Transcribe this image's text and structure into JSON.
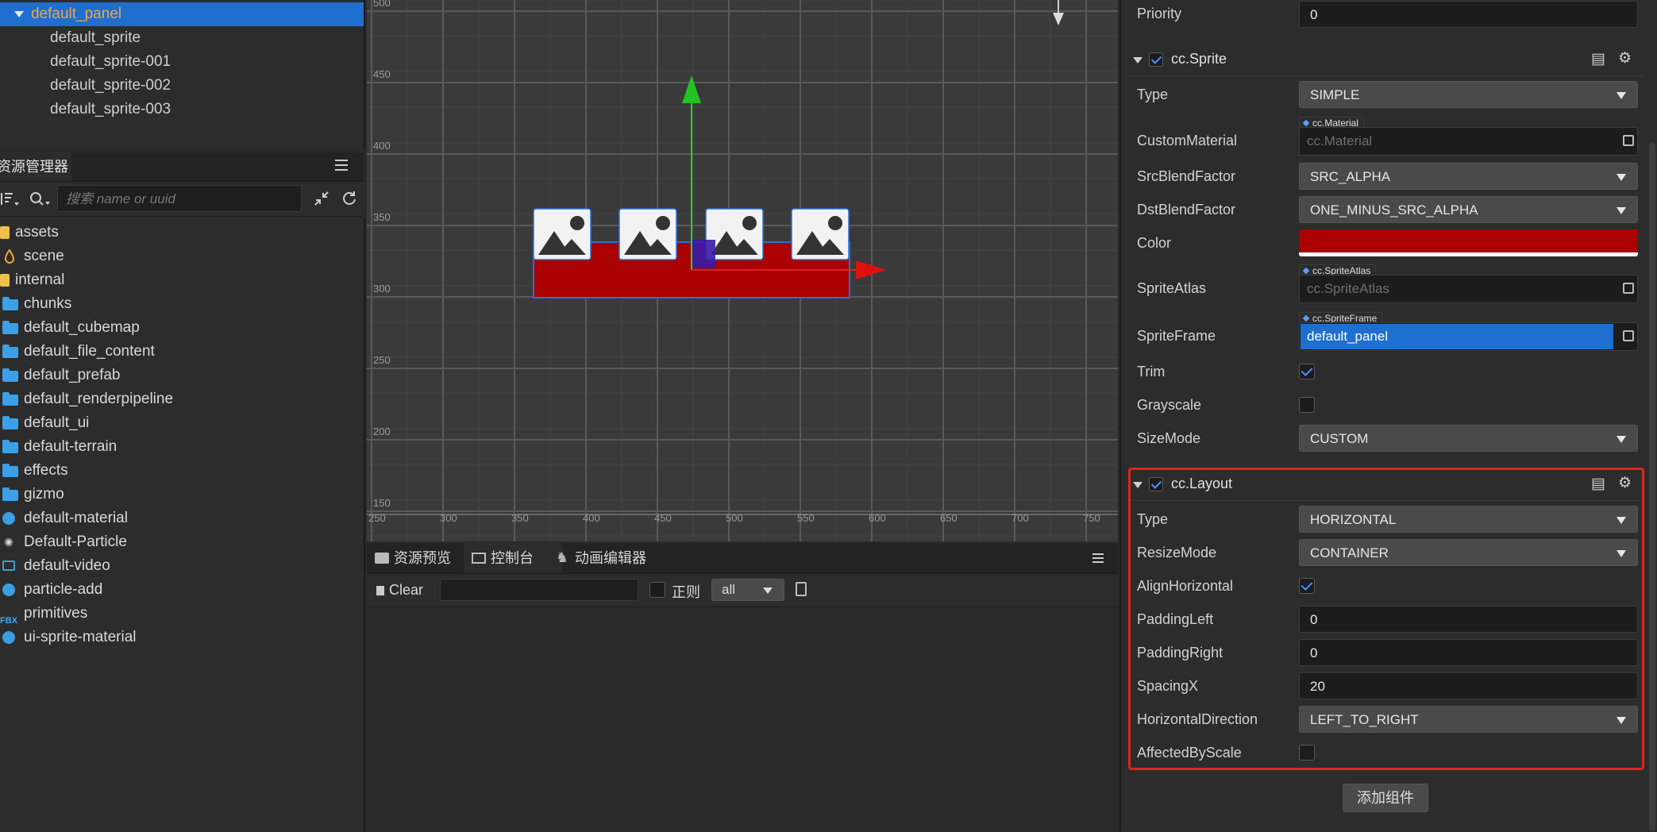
{
  "hierarchy": {
    "items": [
      {
        "label": "default_panel",
        "selected": true
      },
      {
        "label": "default_sprite"
      },
      {
        "label": "default_sprite-001"
      },
      {
        "label": "default_sprite-002"
      },
      {
        "label": "default_sprite-003"
      }
    ]
  },
  "assets": {
    "tab_label": "资源管理器",
    "search_placeholder": "搜索 name or uuid",
    "items": [
      {
        "label": "assets",
        "icon": "database-icon"
      },
      {
        "label": "scene",
        "icon": "scene-icon"
      },
      {
        "label": "internal",
        "icon": "database-icon"
      },
      {
        "label": "chunks",
        "icon": "folder-icon"
      },
      {
        "label": "default_cubemap",
        "icon": "folder-icon"
      },
      {
        "label": "default_file_content",
        "icon": "folder-icon"
      },
      {
        "label": "default_prefab",
        "icon": "folder-icon"
      },
      {
        "label": "default_renderpipeline",
        "icon": "folder-icon"
      },
      {
        "label": "default_ui",
        "icon": "folder-icon"
      },
      {
        "label": "default-terrain",
        "icon": "folder-icon"
      },
      {
        "label": "effects",
        "icon": "folder-icon"
      },
      {
        "label": "gizmo",
        "icon": "folder-icon"
      },
      {
        "label": "default-material",
        "icon": "material-icon"
      },
      {
        "label": "Default-Particle",
        "icon": "particle-icon"
      },
      {
        "label": "default-video",
        "icon": "video-icon"
      },
      {
        "label": "particle-add",
        "icon": "material-icon"
      },
      {
        "label": "primitives",
        "icon": "fbx-icon"
      },
      {
        "label": "ui-sprite-material",
        "icon": "material-icon"
      }
    ],
    "fbx_badge": "FBX"
  },
  "scene": {
    "y_ticks": [
      "500",
      "450",
      "400",
      "350",
      "300",
      "250",
      "200",
      "150"
    ],
    "x_ticks": [
      "250",
      "300",
      "350",
      "400",
      "450",
      "500",
      "550",
      "600",
      "650",
      "700",
      "750"
    ],
    "panel_color": "#aa0000"
  },
  "console": {
    "tabs": [
      {
        "label": "资源预览",
        "icon": "preview-icon"
      },
      {
        "label": "控制台",
        "icon": "console-icon"
      },
      {
        "label": "动画编辑器",
        "icon": "animation-icon"
      }
    ],
    "clear_label": "Clear",
    "regex_label": "正则",
    "level_value": "all"
  },
  "inspector": {
    "priority_label": "Priority",
    "priority_value": "0",
    "sprite": {
      "title": "cc.Sprite",
      "type_label": "Type",
      "type_value": "SIMPLE",
      "custom_material_label": "CustomMaterial",
      "custom_material_tag": "cc.Material",
      "custom_material_placeholder": "cc.Material",
      "src_blend_label": "SrcBlendFactor",
      "src_blend_value": "SRC_ALPHA",
      "dst_blend_label": "DstBlendFactor",
      "dst_blend_value": "ONE_MINUS_SRC_ALPHA",
      "color_label": "Color",
      "color_value": "#aa0000",
      "sprite_atlas_label": "SpriteAtlas",
      "sprite_atlas_tag": "cc.SpriteAtlas",
      "sprite_atlas_placeholder": "cc.SpriteAtlas",
      "sprite_frame_label": "SpriteFrame",
      "sprite_frame_tag": "cc.SpriteFrame",
      "sprite_frame_value": "default_panel",
      "trim_label": "Trim",
      "trim_checked": true,
      "grayscale_label": "Grayscale",
      "grayscale_checked": false,
      "size_mode_label": "SizeMode",
      "size_mode_value": "CUSTOM"
    },
    "layout": {
      "title": "cc.Layout",
      "type_label": "Type",
      "type_value": "HORIZONTAL",
      "resize_mode_label": "ResizeMode",
      "resize_mode_value": "CONTAINER",
      "align_horizontal_label": "AlignHorizontal",
      "align_horizontal_checked": true,
      "padding_left_label": "PaddingLeft",
      "padding_left_value": "0",
      "padding_right_label": "PaddingRight",
      "padding_right_value": "0",
      "spacing_x_label": "SpacingX",
      "spacing_x_value": "20",
      "horizontal_direction_label": "HorizontalDirection",
      "horizontal_direction_value": "LEFT_TO_RIGHT",
      "affected_by_scale_label": "AffectedByScale",
      "affected_by_scale_checked": false
    },
    "add_component_label": "添加组件",
    "highlight_color": "#e0241c"
  }
}
